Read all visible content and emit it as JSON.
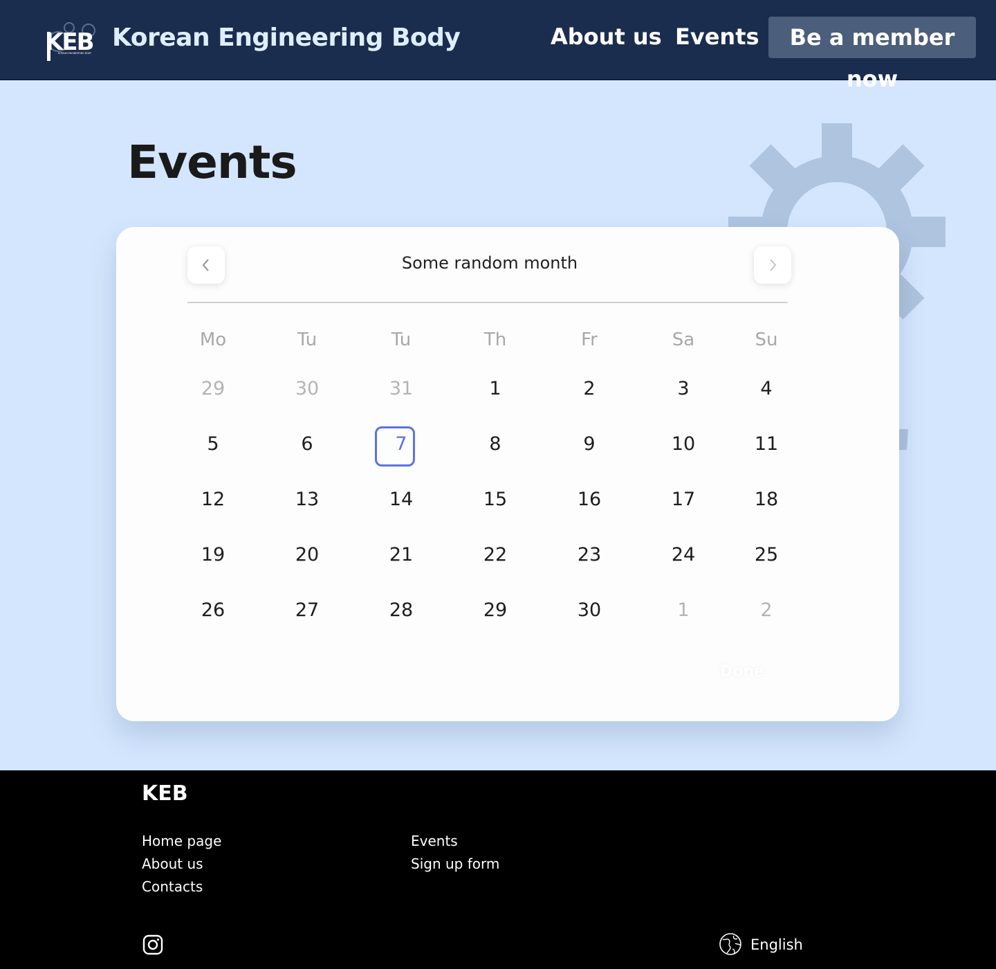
{
  "header": {
    "logo_text": "KEB",
    "logo_subtitle": "KOREAN ENGINEERING BODY",
    "brand": "Korean Engineering Body",
    "nav": {
      "about": "About us",
      "events": "Events"
    },
    "cta": "Be a member now"
  },
  "main": {
    "title": "Events"
  },
  "calendar": {
    "month": "Some random month",
    "weekdays": [
      "Mo",
      "Tu",
      "Tu",
      "Th",
      "Fr",
      "Sa",
      "Su"
    ],
    "weeks": [
      [
        "29",
        "30",
        "31",
        "1",
        "2",
        "3",
        "4"
      ],
      [
        "5",
        "6",
        "7",
        "8",
        "9",
        "10",
        "11"
      ],
      [
        "12",
        "13",
        "14",
        "15",
        "16",
        "17",
        "18"
      ],
      [
        "19",
        "20",
        "21",
        "22",
        "23",
        "24",
        "25"
      ],
      [
        "26",
        "27",
        "28",
        "29",
        "30",
        "1",
        "2"
      ]
    ],
    "outside_month": [
      [
        0,
        0
      ],
      [
        0,
        1
      ],
      [
        0,
        2
      ],
      [
        4,
        5
      ],
      [
        4,
        6
      ]
    ],
    "selected": [
      1,
      2
    ],
    "done_label": "Done",
    "accent": "#5a73e0"
  },
  "footer": {
    "logo": "KEB",
    "col1": [
      "Home page",
      "About us",
      "Contacts"
    ],
    "col2": [
      "Events",
      "Sign up form"
    ],
    "language": "English"
  },
  "colors": {
    "header_bg": "#1b2d4f",
    "page_bg": "#d4e6fd",
    "footer_bg": "#000000",
    "cta_bg": "#4b5e7b"
  }
}
